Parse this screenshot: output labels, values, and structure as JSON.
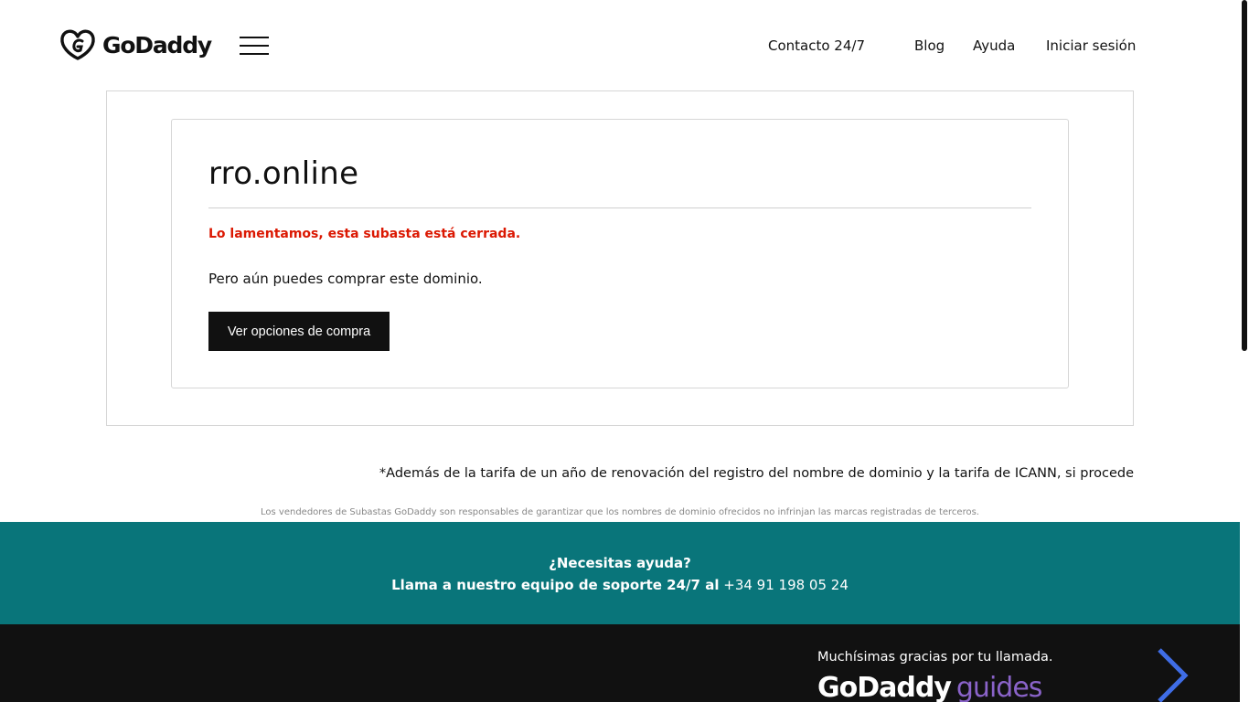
{
  "header": {
    "logo_text": "GoDaddy",
    "nav": {
      "contact": "Contacto 24/7",
      "blog": "Blog",
      "help": "Ayuda",
      "login": "Iniciar sesión"
    }
  },
  "auction": {
    "domain": "rro.online",
    "closed_message": "Lo lamentamos, esta subasta está cerrada.",
    "buy_message": "Pero aún puedes comprar este dominio.",
    "buy_button": "Ver opciones de compra"
  },
  "notes": {
    "fee_note": "*Además de la tarifa de un año de renovación del registro del nombre de dominio y la tarifa de ICANN, si procede",
    "disclaimer": "Los vendedores de Subastas GoDaddy son responsables de garantizar que los nombres de dominio ofrecidos no infrinjan las marcas registradas de terceros."
  },
  "help_band": {
    "question": "¿Necesitas ayuda?",
    "call_text": "Llama a nuestro equipo de soporte 24/7 al",
    "phone": "+34 91 198 05 24"
  },
  "footer": {
    "thanks": "Muchísimas gracias por tu llamada.",
    "guides_brand": "GoDaddy",
    "guides_word": "guides"
  },
  "colors": {
    "error_red": "#db1802",
    "help_teal": "#09757a",
    "dark": "#111111",
    "guides_purple": "#8a63c9"
  }
}
